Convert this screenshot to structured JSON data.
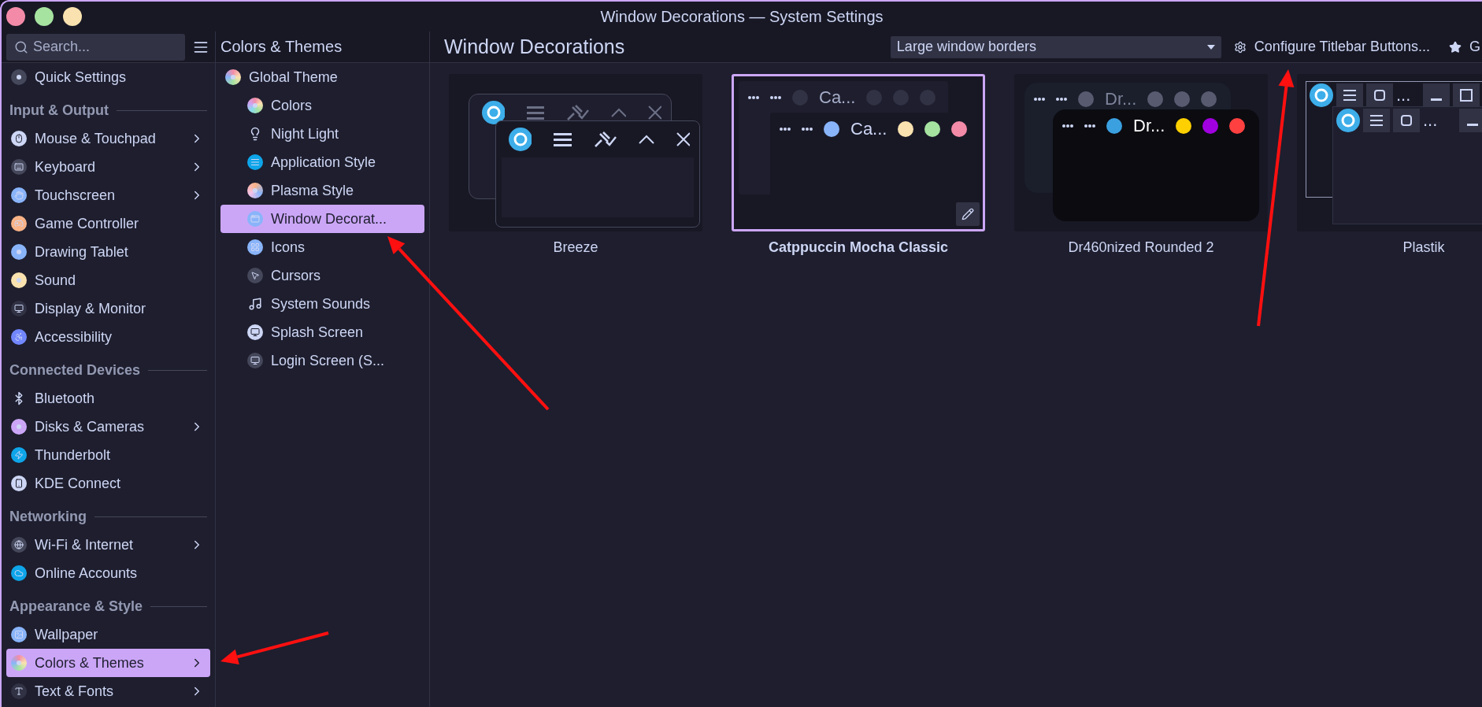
{
  "window": {
    "title": "Window Decorations — System Settings"
  },
  "sidebar": {
    "search": {
      "placeholder": "Search..."
    },
    "sections": [
      {
        "items": [
          {
            "label": "Quick Settings",
            "expandable": false,
            "selected": false
          }
        ]
      },
      {
        "heading": "Input & Output",
        "items": [
          {
            "label": "Mouse & Touchpad",
            "expandable": true,
            "selected": false
          },
          {
            "label": "Keyboard",
            "expandable": true,
            "selected": false
          },
          {
            "label": "Touchscreen",
            "expandable": true,
            "selected": false
          },
          {
            "label": "Game Controller",
            "expandable": false,
            "selected": false
          },
          {
            "label": "Drawing Tablet",
            "expandable": false,
            "selected": false
          },
          {
            "label": "Sound",
            "expandable": false,
            "selected": false
          },
          {
            "label": "Display & Monitor",
            "expandable": false,
            "selected": false
          },
          {
            "label": "Accessibility",
            "expandable": false,
            "selected": false
          }
        ]
      },
      {
        "heading": "Connected Devices",
        "items": [
          {
            "label": "Bluetooth",
            "expandable": false,
            "selected": false
          },
          {
            "label": "Disks & Cameras",
            "expandable": true,
            "selected": false
          },
          {
            "label": "Thunderbolt",
            "expandable": false,
            "selected": false
          },
          {
            "label": "KDE Connect",
            "expandable": false,
            "selected": false
          }
        ]
      },
      {
        "heading": "Networking",
        "items": [
          {
            "label": "Wi-Fi & Internet",
            "expandable": true,
            "selected": false
          },
          {
            "label": "Online Accounts",
            "expandable": false,
            "selected": false
          }
        ]
      },
      {
        "heading": "Appearance & Style",
        "items": [
          {
            "label": "Wallpaper",
            "expandable": false,
            "selected": false
          },
          {
            "label": "Colors & Themes",
            "expandable": true,
            "selected": true
          },
          {
            "label": "Text & Fonts",
            "expandable": true,
            "selected": false
          }
        ]
      }
    ]
  },
  "category": {
    "title": "Colors & Themes",
    "items": [
      {
        "label": "Global Theme",
        "selected": false,
        "children": [
          {
            "label": "Colors",
            "selected": false
          },
          {
            "label": "Night Light",
            "selected": false
          },
          {
            "label": "Application Style",
            "selected": false
          },
          {
            "label": "Plasma Style",
            "selected": false
          },
          {
            "label": "Window Decorat...",
            "selected": true
          },
          {
            "label": "Icons",
            "selected": false
          },
          {
            "label": "Cursors",
            "selected": false
          },
          {
            "label": "System Sounds",
            "selected": false
          },
          {
            "label": "Splash Screen",
            "selected": false
          },
          {
            "label": "Login Screen (S...",
            "selected": false
          }
        ]
      }
    ]
  },
  "page": {
    "title": "Window Decorations",
    "border_size": {
      "value": "Large window borders"
    },
    "configure_button": "Configure Titlebar Buttons...",
    "get_new_button": "G",
    "themes": [
      {
        "name": "Breeze",
        "kind": "breeze",
        "selected": false
      },
      {
        "name": "Catppuccin Mocha Classic",
        "kind": "catppuccin",
        "selected": true,
        "back_title": "Ca...",
        "front_title": "Ca..."
      },
      {
        "name": "Dr460nized Rounded 2",
        "kind": "dragonized",
        "selected": false,
        "back_title": "Dr...",
        "front_title": "Dr..."
      },
      {
        "name": "Plastik",
        "kind": "plastik",
        "selected": false,
        "back_title": "...",
        "front_title": "..."
      }
    ]
  }
}
